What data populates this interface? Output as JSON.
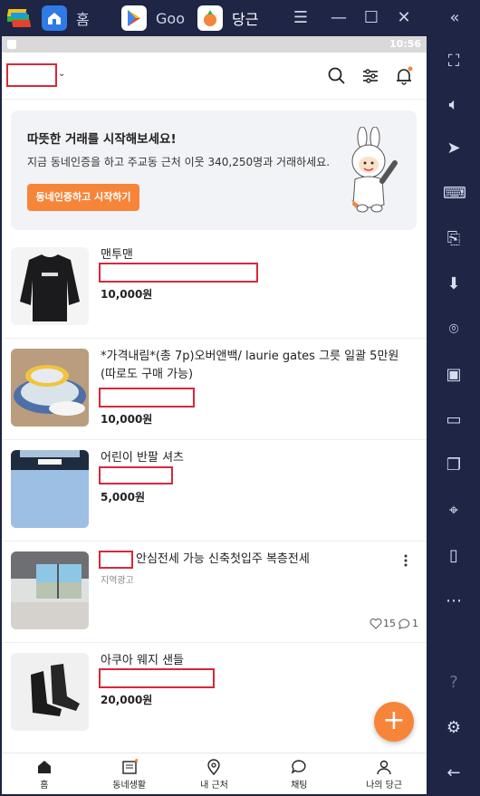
{
  "tabs": [
    {
      "label": "홈"
    },
    {
      "label": "Goo"
    },
    {
      "label": "당근"
    }
  ],
  "status": {
    "time": "10:56"
  },
  "banner": {
    "heading": "따뜻한 거래를 시작해보세요!",
    "text": "지금 동네인증을 하고 주교동 근처 이웃 340,250명과 거래하세요.",
    "button": "동네인증하고 시작하기"
  },
  "items": [
    {
      "title": "맨투맨",
      "price": "10,000원"
    },
    {
      "title": "*가격내림*(총 7p)오버앤백/ laurie gates 그릇 일괄 5만원 (따로도 구매 가능)",
      "price": "10,000원"
    },
    {
      "title": "어린이 반팔 셔츠",
      "price": "5,000원"
    },
    {
      "title": "안심전세  가능 신축첫입주 복층전세",
      "sub": "지역광고",
      "likes": "15",
      "comments": "1"
    },
    {
      "title": "아쿠아 웨지 샌들",
      "price": "20,000원"
    }
  ],
  "nav": [
    {
      "label": "홈"
    },
    {
      "label": "동네생활"
    },
    {
      "label": "내 근처"
    },
    {
      "label": "채팅"
    },
    {
      "label": "나의 당근"
    }
  ],
  "colors": {
    "accent": "#f6853a",
    "redaction": "#d8283a",
    "emulator_bg": "#1e2545"
  }
}
